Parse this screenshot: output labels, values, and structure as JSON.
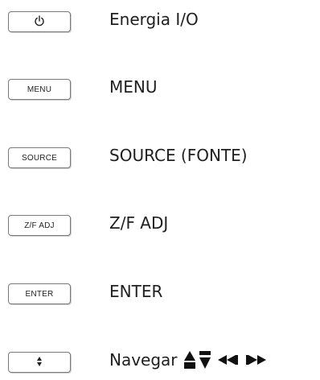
{
  "rows": [
    {
      "key_label": "",
      "key_icon": "power-icon",
      "description": "Energia I/O"
    },
    {
      "key_label": "MENU",
      "description": "MENU"
    },
    {
      "key_label": "SOURCE",
      "description": "SOURCE (FONTE)"
    },
    {
      "key_label": "Z/F ADJ",
      "description": "Z/F ADJ"
    },
    {
      "key_label": "ENTER",
      "description": "ENTER"
    },
    {
      "key_label": "",
      "key_icon": "up-down-arrows-icon",
      "description": "Navegar"
    }
  ],
  "nav_icons": [
    "up-triangle-icon",
    "down-triangle-icon",
    "left-double-triangle-icon",
    "right-double-triangle-icon"
  ]
}
